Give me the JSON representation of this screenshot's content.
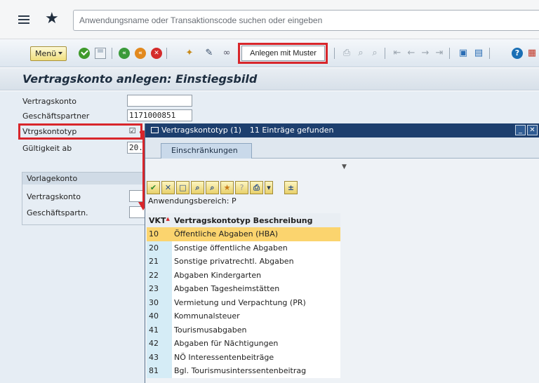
{
  "topbar": {
    "search_placeholder": "Anwendungsname oder Transaktionscode suchen oder eingeben"
  },
  "toolbar": {
    "menu_label": "Menü",
    "muster_button_label": "Anlegen mit Muster",
    "icons": [
      "check-icon",
      "save-icon",
      "back-icon",
      "exit-icon",
      "cancel-icon",
      "create-icon",
      "edit-icon",
      "glasses-icon",
      "print-icon",
      "find-icon",
      "find-next-icon",
      "first-page-icon",
      "previous-page-icon",
      "next-page-icon",
      "last-page-icon",
      "new-session-icon",
      "shortcut-icon",
      "help-icon",
      "layout-icon"
    ]
  },
  "page": {
    "title": "Vertragskonto anlegen: Einstiegsbild"
  },
  "form": {
    "vertragskonto_label": "Vertragskonto",
    "vertragskonto_value": "",
    "geschaeftspartner_label": "Geschäftspartner",
    "geschaeftspartner_value": "1171000851",
    "vtrgskontotyp_label": "Vtrgskontotyp",
    "gueltigkeit_label": "Gültigkeit ab",
    "gueltigkeit_value": "20.",
    "vorlage": {
      "title": "Vorlagekonto",
      "vertragskonto_label": "Vertragskonto",
      "geschaeftspartner_label": "Geschäftspartn."
    }
  },
  "popup": {
    "title": "Vertragskontotyp (1)",
    "count_text": "11 Einträge gefunden",
    "tab_label": "Einschränkungen",
    "area_label": "Anwendungsbereich: P",
    "table": {
      "headers": [
        "VKT",
        "Vertragskontotyp Beschreibung"
      ],
      "rows": [
        {
          "code": "10",
          "desc": "Öffentliche Abgaben (HBA)",
          "selected": true
        },
        {
          "code": "20",
          "desc": "Sonstige öffentliche Abgaben"
        },
        {
          "code": "21",
          "desc": "Sonstige privatrechtl. Abgaben"
        },
        {
          "code": "22",
          "desc": "Abgaben Kindergarten"
        },
        {
          "code": "23",
          "desc": "Abgaben Tagesheimstätten"
        },
        {
          "code": "30",
          "desc": "Vermietung und Verpachtung (PR)"
        },
        {
          "code": "40",
          "desc": "Kommunalsteuer"
        },
        {
          "code": "41",
          "desc": "Tourismusabgaben"
        },
        {
          "code": "42",
          "desc": "Abgaben für Nächtigungen"
        },
        {
          "code": "43",
          "desc": "NÖ Interessentenbeiträge"
        },
        {
          "code": "81",
          "desc": "Bgl. Tourismusinterssentenbeitrag"
        }
      ]
    }
  },
  "colors": {
    "highlight": "#d8262b",
    "popup_header": "#1d3f6e",
    "selected_row": "#fbd46e"
  }
}
